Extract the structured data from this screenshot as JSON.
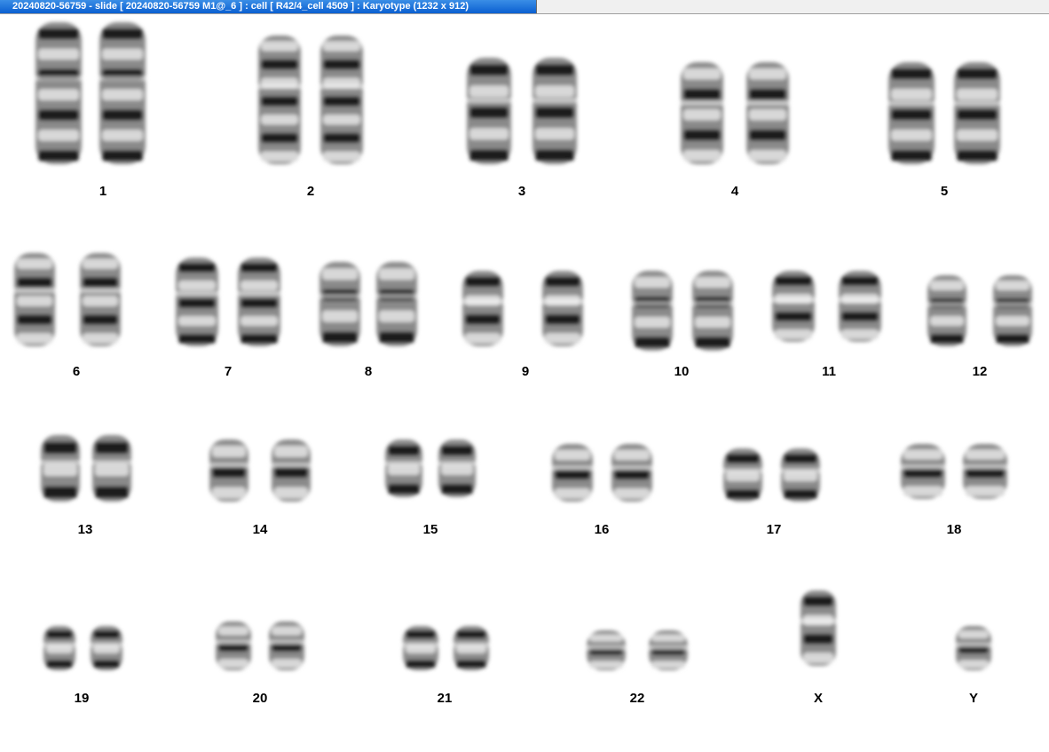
{
  "window": {
    "title": "20240820-56759 - slide [ 20240820-56759 M1@_6 ] : cell [ R42/4_cell 4509 ] : Karyotype  (1232 x 912)"
  },
  "karyotype": {
    "labels": [
      "1",
      "2",
      "3",
      "4",
      "5",
      "6",
      "7",
      "8",
      "9",
      "10",
      "11",
      "12",
      "13",
      "14",
      "15",
      "16",
      "17",
      "18",
      "19",
      "20",
      "21",
      "22",
      "X",
      "Y"
    ]
  }
}
